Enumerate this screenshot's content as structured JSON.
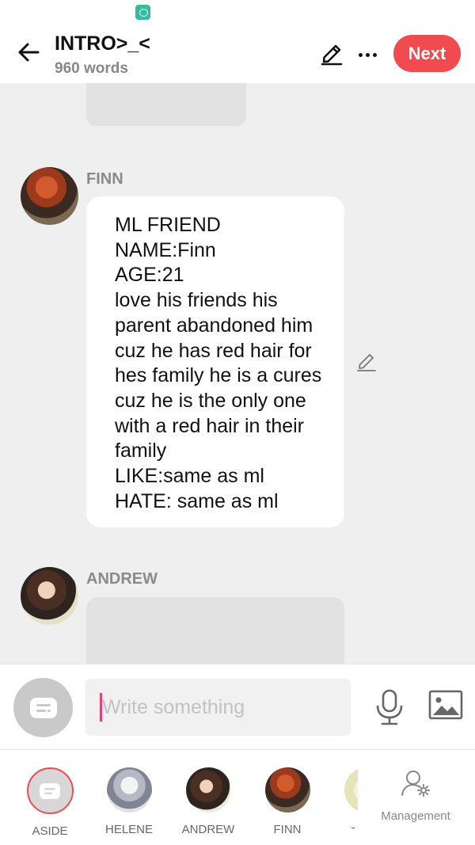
{
  "header": {
    "title": "INTRO>_<",
    "subtitle": "960 words",
    "next_label": "Next"
  },
  "messages": [
    {
      "speaker": "FINN",
      "text": "ML FRIEND\nNAME:Finn\nAGE:21\nlove his friends his parent abandoned him cuz he has red hair for hes family he is a cures cuz he is the only one with a red hair in their family\nLIKE:same as ml\nHATE: same as ml"
    },
    {
      "speaker": "ANDREW",
      "text": ""
    }
  ],
  "input": {
    "placeholder": "Write something",
    "value": ""
  },
  "characters": [
    {
      "label": "ASIDE"
    },
    {
      "label": "HELENE"
    },
    {
      "label": "ANDREW"
    },
    {
      "label": "FINN"
    }
  ],
  "management_label": "Management",
  "colors": {
    "accent": "#f24b4f",
    "caret": "#e8427a",
    "background": "#efefef"
  },
  "icons": [
    "back-arrow-icon",
    "pencil-icon",
    "more-icon",
    "aside-icon",
    "microphone-icon",
    "image-icon",
    "user-settings-icon"
  ]
}
